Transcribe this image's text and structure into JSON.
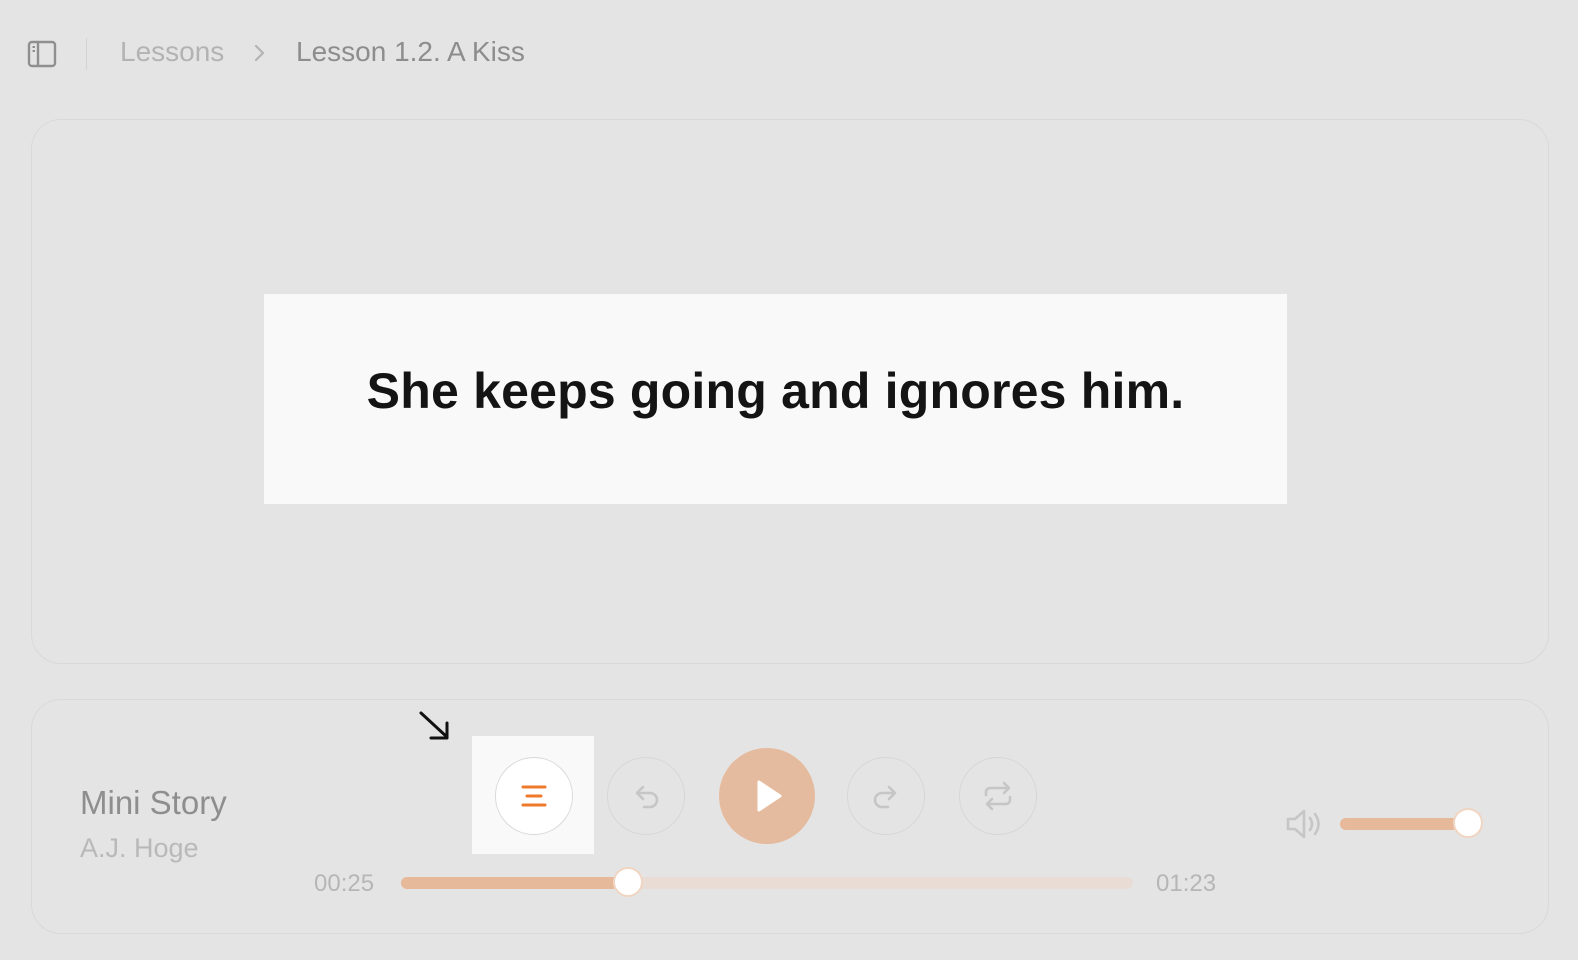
{
  "breadcrumb": {
    "root_label": "Lessons",
    "current_label": "Lesson 1.2. A Kiss"
  },
  "caption": {
    "text": "She keeps going and ignores him."
  },
  "player": {
    "track_title": "Mini Story",
    "track_artist": "A.J. Hoge",
    "time_current": "00:25",
    "time_total": "01:23",
    "progress": 0.31,
    "volume": 1.0,
    "accent_color": "#e5bb9f",
    "active_icon_color": "#ef7a2c",
    "controls": [
      {
        "name": "transcript",
        "icon": "align-center-icon",
        "active": true
      },
      {
        "name": "rewind",
        "icon": "undo-icon"
      },
      {
        "name": "play",
        "icon": "play-icon"
      },
      {
        "name": "forward",
        "icon": "redo-icon"
      },
      {
        "name": "repeat",
        "icon": "repeat-icon"
      }
    ]
  }
}
